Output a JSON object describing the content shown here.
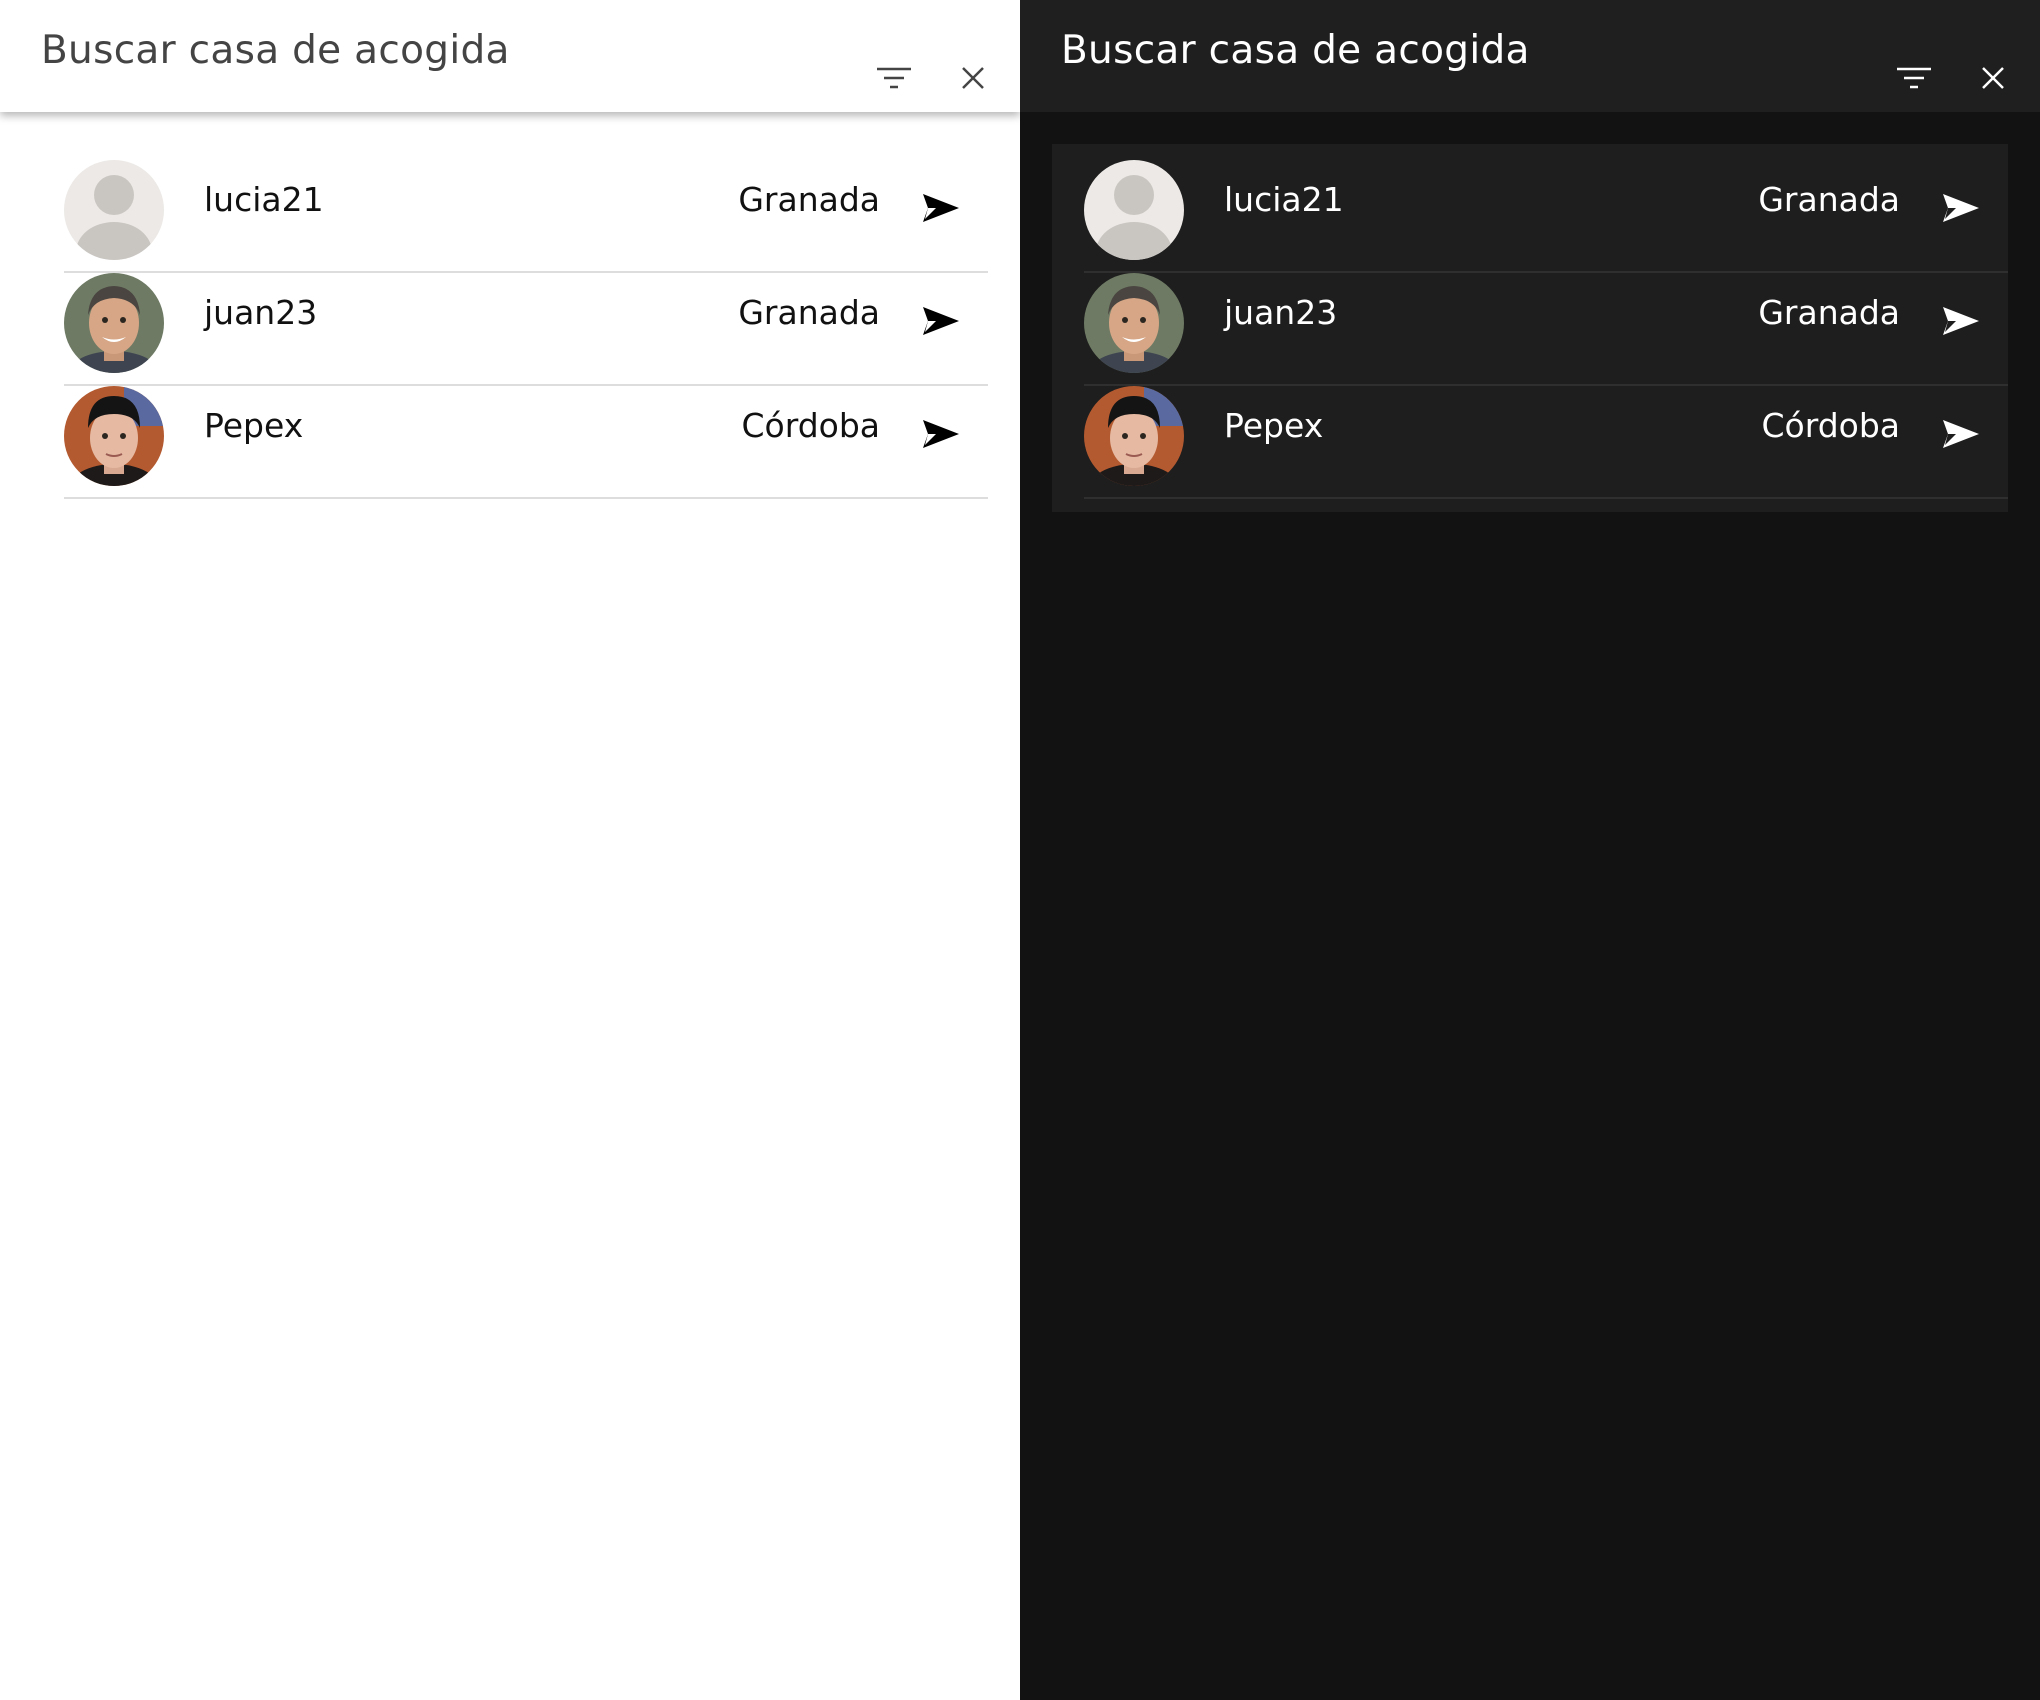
{
  "title": "Buscar casa de acogida",
  "header_icons": {
    "filter": "filter-icon",
    "close": "close-icon"
  },
  "items": [
    {
      "username": "lucia21",
      "city": "Granada",
      "avatar": "default-avatar"
    },
    {
      "username": "juan23",
      "city": "Granada",
      "avatar": "photo-avatar"
    },
    {
      "username": "Pepex",
      "city": "Córdoba",
      "avatar": "photo-avatar"
    }
  ],
  "themes": {
    "light": {
      "background": "#ffffff",
      "text": "#111111",
      "title": "#444444"
    },
    "dark": {
      "background": "#121212",
      "surface": "#1e1e1e",
      "header": "#1f1f1f",
      "text": "#ffffff"
    }
  }
}
